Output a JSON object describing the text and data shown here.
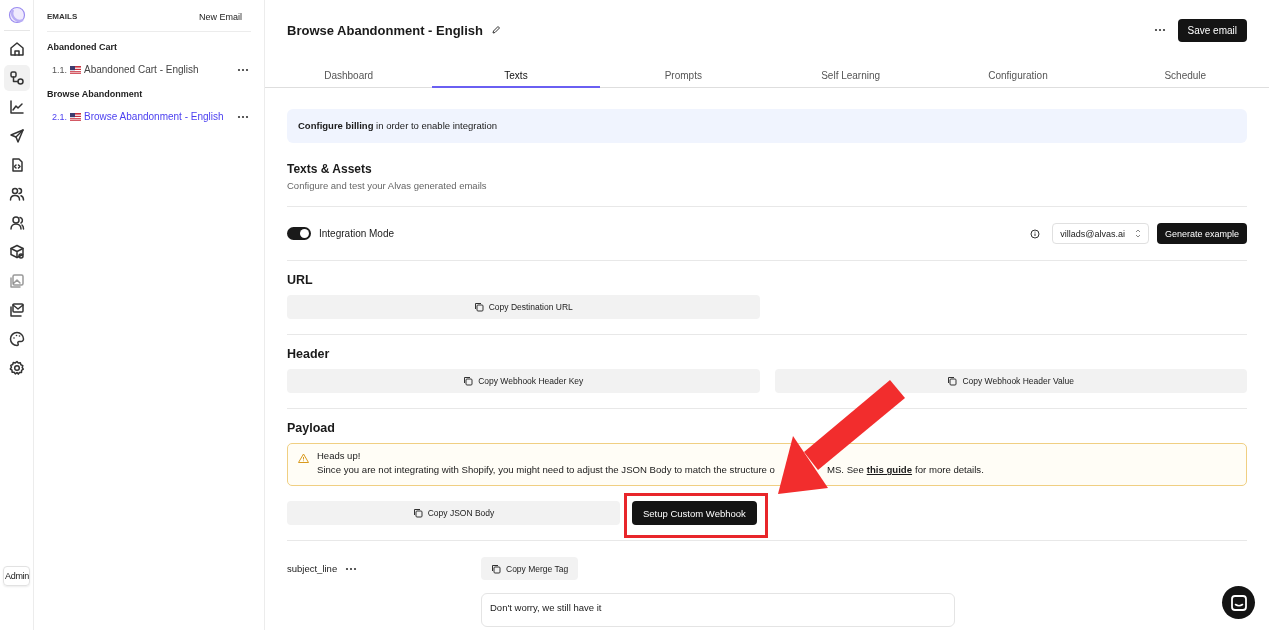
{
  "rail": {
    "items": [
      {
        "kind": "home",
        "selected": false
      },
      {
        "kind": "flow",
        "selected": true
      },
      {
        "kind": "chart",
        "selected": false
      },
      {
        "kind": "send",
        "selected": false
      },
      {
        "kind": "code",
        "selected": false
      },
      {
        "kind": "users",
        "selected": false
      },
      {
        "kind": "people",
        "selected": false
      },
      {
        "kind": "package",
        "selected": false
      },
      {
        "kind": "image",
        "selected": false
      },
      {
        "kind": "mail",
        "selected": false
      },
      {
        "kind": "palette",
        "selected": false
      },
      {
        "kind": "settings",
        "selected": false
      }
    ],
    "admin_button": "Admin"
  },
  "sidebar": {
    "heading": "EMAILS",
    "new_button": "New Email",
    "groups": [
      {
        "title": "Abandoned Cart",
        "items": [
          {
            "number": "1.1.",
            "label": "Abandoned Cart - English",
            "selected": false
          }
        ]
      },
      {
        "title": "Browse Abandonment",
        "items": [
          {
            "number": "2.1.",
            "label": "Browse Abandonment - English",
            "selected": true
          }
        ]
      }
    ]
  },
  "header": {
    "title": "Browse Abandonment - English",
    "save_button": "Save email"
  },
  "tabs": [
    {
      "label": "Dashboard",
      "selected": false
    },
    {
      "label": "Texts",
      "selected": true
    },
    {
      "label": "Prompts",
      "selected": false
    },
    {
      "label": "Self Learning",
      "selected": false
    },
    {
      "label": "Configuration",
      "selected": false
    },
    {
      "label": "Schedule",
      "selected": false
    }
  ],
  "banner": "**Configure billing** in order to enable integration",
  "intro": {
    "title": "Texts & Assets",
    "subtitle": "Configure and test your Alvas generated emails"
  },
  "integration": {
    "label": "Integration Mode",
    "on": true,
    "email": "villads@alvas.ai",
    "generate_button": "Generate example"
  },
  "url": {
    "title": "URL",
    "buttons": [
      "Copy Destination URL"
    ]
  },
  "headers": {
    "title": "Header",
    "buttons": [
      "Copy Webhook Header Key",
      "Copy Webhook Header Value"
    ]
  },
  "payload": {
    "title": "Payload",
    "alert": {
      "title": "Heads up!",
      "text_start": "Since you are not integrating with Shopify, you might need to adjust the JSON Body to match the structure o",
      "text_resume": "MS. See",
      "link": "this guide",
      "text_end": "for more details."
    },
    "copy_button": "Copy JSON Body",
    "setup_button": "Setup Custom Webhook"
  },
  "fields": [
    {
      "name": "subject_line",
      "copy_button": "Copy Merge Tag",
      "value": "Don't worry, we still have it"
    }
  ]
}
